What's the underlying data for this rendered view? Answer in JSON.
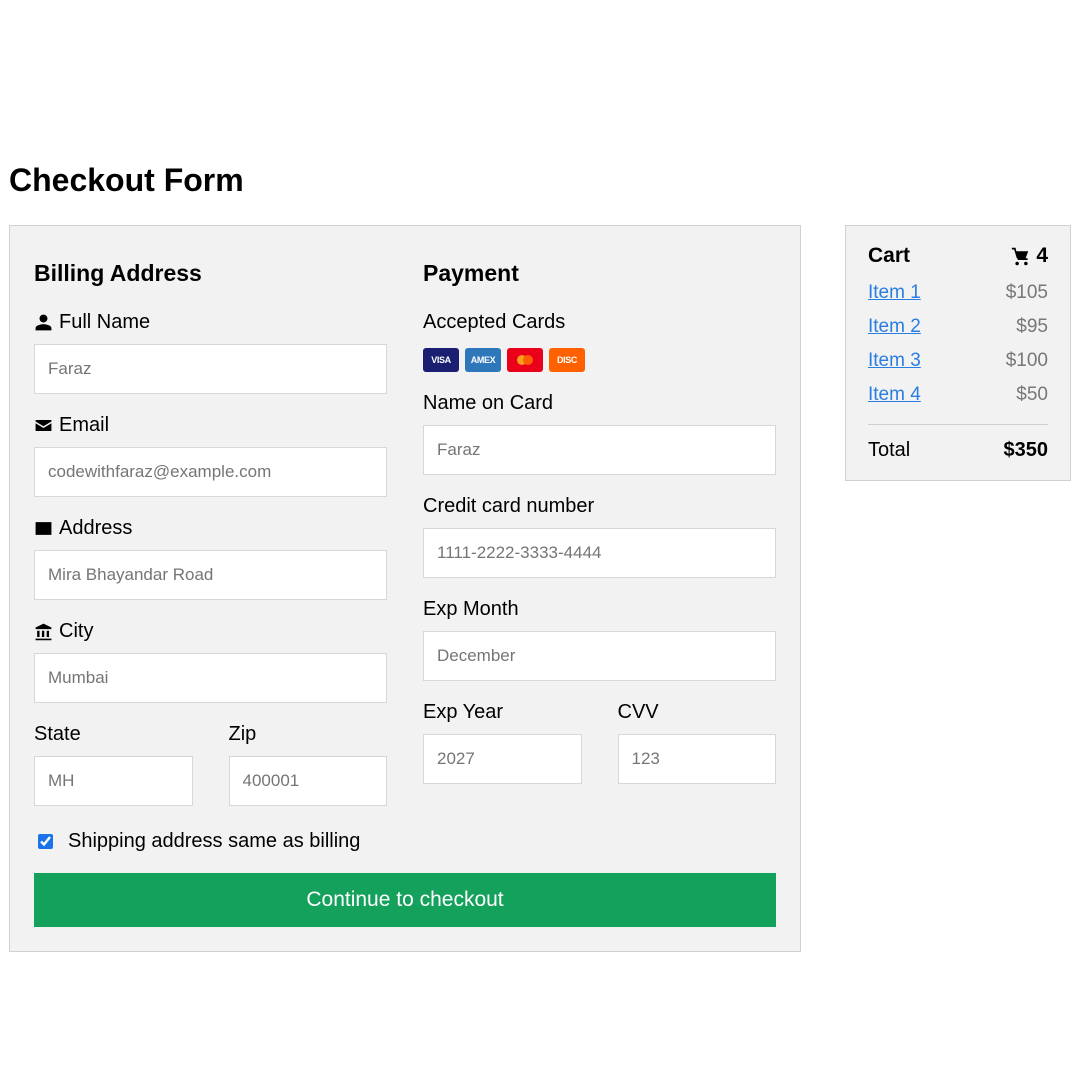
{
  "page": {
    "title": "Checkout Form"
  },
  "billing": {
    "heading": "Billing Address",
    "fullname_label": "Full Name",
    "fullname_ph": "Faraz",
    "email_label": "Email",
    "email_ph": "codewithfaraz@example.com",
    "address_label": "Address",
    "address_ph": "Mira Bhayandar Road",
    "city_label": "City",
    "city_ph": "Mumbai",
    "state_label": "State",
    "state_ph": "MH",
    "zip_label": "Zip",
    "zip_ph": "400001"
  },
  "payment": {
    "heading": "Payment",
    "accepted_label": "Accepted Cards",
    "name_label": "Name on Card",
    "name_ph": "Faraz",
    "ccnum_label": "Credit card number",
    "ccnum_ph": "1111-2222-3333-4444",
    "expmonth_label": "Exp Month",
    "expmonth_ph": "December",
    "expyear_label": "Exp Year",
    "expyear_ph": "2027",
    "cvv_label": "CVV",
    "cvv_ph": "123"
  },
  "shipping_same_label": "Shipping address same as billing",
  "checkout_button": "Continue to checkout",
  "cart": {
    "title": "Cart",
    "count": "4",
    "items": [
      {
        "name": "Item 1",
        "price": "$105"
      },
      {
        "name": "Item 2",
        "price": "$95"
      },
      {
        "name": "Item 3",
        "price": "$100"
      },
      {
        "name": "Item 4",
        "price": "$50"
      }
    ],
    "total_label": "Total",
    "total_value": "$350"
  },
  "card_brands": {
    "visa": "VISA",
    "amex": "AMEX",
    "discover": "DISC"
  }
}
